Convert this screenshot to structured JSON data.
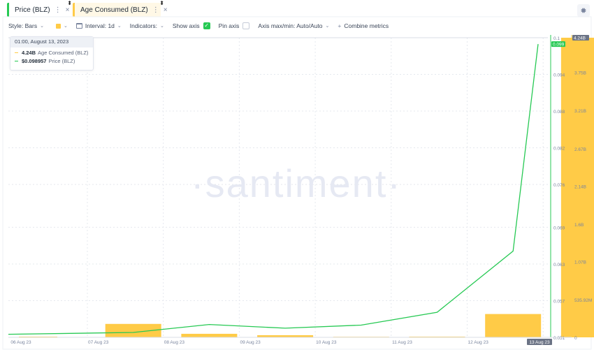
{
  "metric_tabs": [
    {
      "label": "Price (BLZ)",
      "color": "#26c953"
    },
    {
      "label": "Age Consumed (BLZ)",
      "color": "#ffcb47"
    }
  ],
  "toolbar": {
    "style_label": "Style: Bars",
    "interval_label": "Interval: 1d",
    "indicators_label": "Indicators:",
    "show_axis_label": "Show axis",
    "show_axis_checked": true,
    "pin_axis_label": "Pin axis",
    "pin_axis_checked": false,
    "axis_minmax_label": "Axis max/min: Auto/Auto",
    "combine_label": "Combine metrics"
  },
  "tooltip": {
    "date": "01:00, August 13, 2023",
    "rows": [
      {
        "value": "4.24B",
        "name": "Age Consumed (BLZ)",
        "color": "#ffcb47"
      },
      {
        "value": "$0.098957",
        "name": "Price (BLZ)",
        "color": "#26c953"
      }
    ]
  },
  "watermark": "·santiment·",
  "chart_data": {
    "type": "bar",
    "categories": [
      "06 Aug 23",
      "07 Aug 23",
      "08 Aug 23",
      "09 Aug 23",
      "10 Aug 23",
      "11 Aug 23",
      "12 Aug 23",
      "13 Aug 23"
    ],
    "x_tick_labels": [
      "06 Aug 23",
      "07 Aug 23",
      "08 Aug 23",
      "09 Aug 23",
      "10 Aug 23",
      "11 Aug 23",
      "12 Aug 23",
      "13 Aug 23"
    ],
    "series": [
      {
        "name": "Age Consumed (BLZ)",
        "type": "bar",
        "axis": "right",
        "color": "#ffcb47",
        "values": [
          0.01,
          0.19,
          0.05,
          0.03,
          0.005,
          0.01,
          0.33,
          4.24
        ],
        "unit": "B"
      },
      {
        "name": "Price (BLZ)",
        "type": "line",
        "axis": "left",
        "color": "#26c953",
        "values": [
          0.0515,
          0.0518,
          0.0531,
          0.0525,
          0.053,
          0.0551,
          0.0651,
          0.098957
        ]
      }
    ],
    "price_axis": {
      "ticks": [
        "0.1",
        "0.094",
        "0.088",
        "0.082",
        "0.076",
        "0.069",
        "0.063",
        "0.057",
        "0.051"
      ],
      "tick_values": [
        0.1,
        0.094,
        0.088,
        0.082,
        0.076,
        0.069,
        0.063,
        0.057,
        0.051
      ],
      "range": [
        0.051,
        0.1
      ],
      "highlight_label": "0.099",
      "highlight_color": "#26c953"
    },
    "age_axis": {
      "ticks": [
        "4.24B",
        "3.75B",
        "3.21B",
        "2.67B",
        "2.14B",
        "1.6B",
        "1.07B",
        "535.92M",
        "0"
      ],
      "tick_values": [
        4.24,
        3.75,
        3.21,
        2.67,
        2.14,
        1.6,
        1.07,
        0.536,
        0
      ],
      "range": [
        0,
        4.24
      ],
      "highlight_label": "4.24B",
      "highlight_color": "#6b7385"
    },
    "highlight_x_label": "13 Aug 23",
    "grid": true,
    "legend": "top-left"
  }
}
